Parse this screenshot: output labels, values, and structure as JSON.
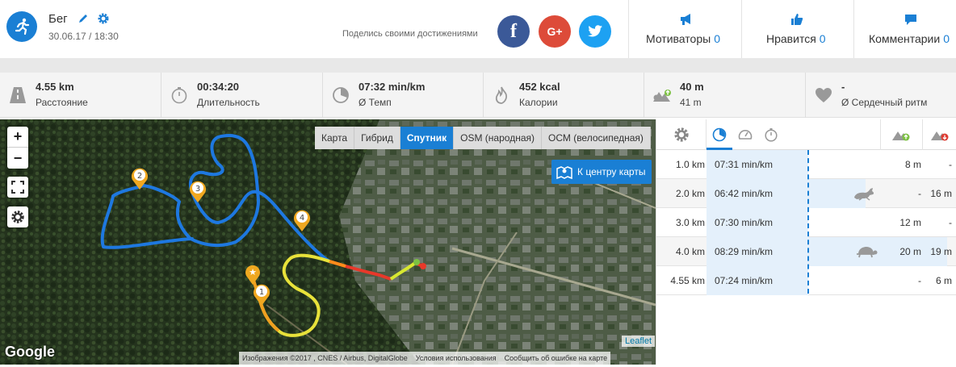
{
  "activity": {
    "title": "Бег",
    "datetime": "30.06.17 / 18:30"
  },
  "share": {
    "label": "Поделись своими достижениями",
    "facebook": "f",
    "google": "G+"
  },
  "header_stats": [
    {
      "label": "Мотиваторы",
      "count": "0",
      "icon": "megaphone-icon"
    },
    {
      "label": "Нравится",
      "count": "0",
      "icon": "thumbs-up-icon"
    },
    {
      "label": "Комментарии",
      "count": "0",
      "icon": "comment-icon"
    }
  ],
  "stats": [
    {
      "value": "4.55 km",
      "label": "Расстояние",
      "icon": "road-icon"
    },
    {
      "value": "00:34:20",
      "label": "Длительность",
      "icon": "stopwatch-icon"
    },
    {
      "value": "07:32 min/km",
      "label": "Ø Темп",
      "icon": "pace-gauge-icon"
    },
    {
      "value": "452 kcal",
      "label": "Калории",
      "icon": "flame-icon"
    },
    {
      "value": "40 m",
      "label": "41 m",
      "icon": "elevation-icon"
    },
    {
      "value": "-",
      "label": "Ø Сердечный ритм",
      "icon": "heart-icon"
    }
  ],
  "map": {
    "zoom_in": "+",
    "zoom_out": "−",
    "layers": [
      "Карта",
      "Гибрид",
      "Спутник",
      "OSM (народная)",
      "ОСМ (велосипедная)"
    ],
    "active_layer": "Спутник",
    "center_button": "К центру карты",
    "google_logo": "Google",
    "attribution": "Изображения ©2017 , CNES / Airbus, DigitalGlobe",
    "terms": "Условия использования",
    "report": "Сообщить об ошибке на карте",
    "leaflet": "Leaflet",
    "km_markers": [
      "1",
      "2",
      "3",
      "4"
    ]
  },
  "splits": {
    "rows": [
      {
        "km": "1.0 km",
        "pace": "07:31 min/km",
        "pace_fraction": 0.0,
        "icon": "",
        "up": "8 m",
        "down": "-"
      },
      {
        "km": "2.0 km",
        "pace": "06:42 min/km",
        "pace_fraction": 0.41,
        "icon": "rabbit-icon",
        "up": "-",
        "down": "16 m"
      },
      {
        "km": "3.0 km",
        "pace": "07:30 min/km",
        "pace_fraction": 0.0,
        "icon": "",
        "up": "12 m",
        "down": "-"
      },
      {
        "km": "4.0 km",
        "pace": "08:29 min/km",
        "pace_fraction": 1.0,
        "icon": "turtle-icon",
        "up": "20 m",
        "down": "19 m"
      },
      {
        "km": "4.55 km",
        "pace": "07:24 min/km",
        "pace_fraction": 0.0,
        "icon": "",
        "up": "-",
        "down": "6 m"
      }
    ]
  },
  "colors": {
    "accent": "#1a7fd4",
    "facebook": "#3b5998",
    "google": "#dd4b39",
    "twitter": "#1da1f2",
    "route": "#1e78e0"
  }
}
